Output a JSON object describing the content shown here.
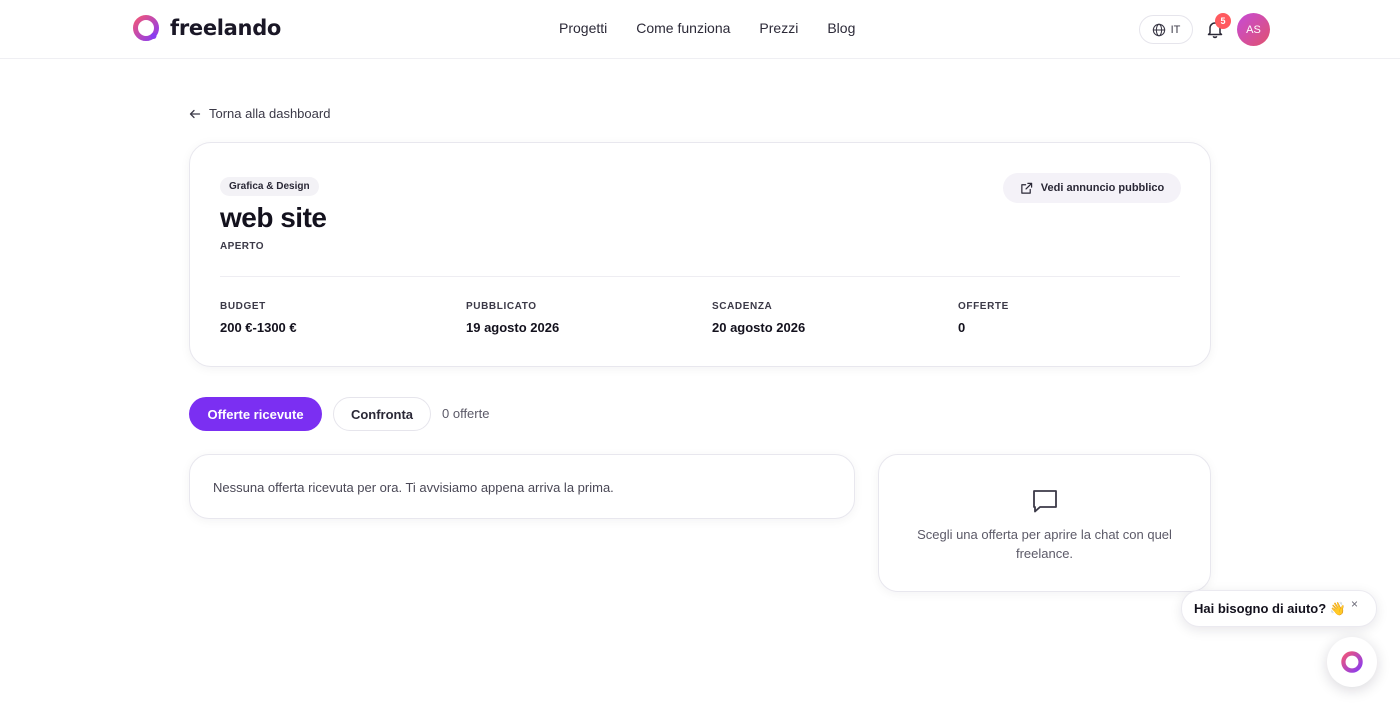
{
  "brand": {
    "name": "freelando",
    "accent": "#7b2ff2",
    "logo_gradient": [
      "#e0526e",
      "#8a3cf0"
    ]
  },
  "nav": [
    "Progetti",
    "Come funziona",
    "Prezzi",
    "Blog"
  ],
  "header": {
    "lang": "IT",
    "notifications": "5",
    "avatar_initials": "AS"
  },
  "back_link": "Torna alla dashboard",
  "project": {
    "category": "Grafica & Design",
    "title": "web site",
    "status": "APERTO",
    "public_button": "Vedi annuncio pubblico",
    "stats": [
      {
        "label": "BUDGET",
        "value": "200 €-1300 €"
      },
      {
        "label": "PUBBLICATO",
        "value": "19 agosto 2026"
      },
      {
        "label": "SCADENZA",
        "value": "20 agosto 2026"
      },
      {
        "label": "OFFERTE",
        "value": "0"
      }
    ]
  },
  "tabs": {
    "active": "Offerte ricevute",
    "compare": "Confronta",
    "count": "0 offerte"
  },
  "offers": {
    "empty": "Nessuna offerta ricevuta per ora. Ti avvisiamo appena arriva la prima."
  },
  "chat": {
    "hint": "Scegli una offerta per aprire la chat con quel freelance."
  },
  "help": {
    "label": "Hai bisogno di aiuto? 👋",
    "close": "×"
  },
  "icons": {
    "back": "arrow-left-icon",
    "globe": "globe-icon",
    "bell": "bell-icon",
    "external": "external-link-icon",
    "chat": "chat-bubble-icon"
  }
}
